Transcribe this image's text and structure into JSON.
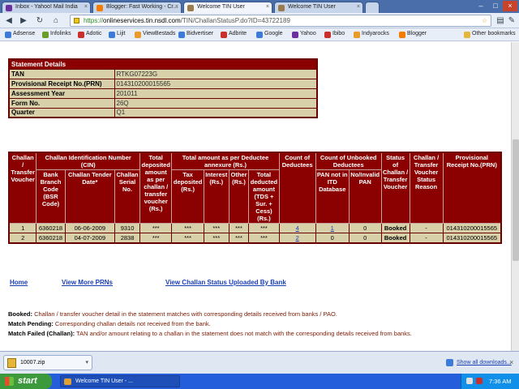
{
  "browser": {
    "tabs": [
      {
        "label": "Inbox - Yahoo! Mail India",
        "color": "#6b2fa0"
      },
      {
        "label": "Blogger: Fast Working - Cr...",
        "color": "#f57c00"
      },
      {
        "label": "Welcome TIN User",
        "color": "#9c7b4a"
      },
      {
        "label": "Welcome TIN User",
        "color": "#9c7b4a"
      }
    ],
    "url_scheme": "https://",
    "url_domain": "onlineservices.tin.nsdl.com",
    "url_path": "/TIN/ChallanStatusP.do?ID=43722189",
    "bookmarks": [
      {
        "label": "Adsense",
        "color": "#3d7bd8"
      },
      {
        "label": "Infolinks",
        "color": "#6a9c2a"
      },
      {
        "label": "Adotic",
        "color": "#c9302c"
      },
      {
        "label": "Lijit",
        "color": "#3d7bd8"
      },
      {
        "label": "ViewBestads",
        "color": "#e89a2a"
      },
      {
        "label": "Bidvertiser",
        "color": "#3d7bd8"
      },
      {
        "label": "Adbrite",
        "color": "#c9302c"
      },
      {
        "label": "Google",
        "color": "#3d7bd8"
      },
      {
        "label": "Yahoo",
        "color": "#6b2fa0"
      },
      {
        "label": "Ibibo",
        "color": "#c9302c"
      },
      {
        "label": "Indyarocks",
        "color": "#e89a2a"
      },
      {
        "label": "Blogger",
        "color": "#f57c00"
      }
    ],
    "other_bookmarks": "Other bookmarks"
  },
  "statement": {
    "header": "Statement Details",
    "rows": [
      {
        "label": "TAN",
        "value": "RTKG07223G"
      },
      {
        "label": "Provisional Receipt No.(PRN)",
        "value": "014310200015565"
      },
      {
        "label": "Assessment Year",
        "value": "201011"
      },
      {
        "label": "Form No.",
        "value": "26Q"
      },
      {
        "label": "Quarter",
        "value": "Q1"
      }
    ]
  },
  "challan": {
    "headers": {
      "voucher": "Challan / Transfer Voucher",
      "cin": "Challan Identification Number (CIN)",
      "bsr": "Bank Branch Code (BSR Code)",
      "tender_date": "Challan Tender Date*",
      "serial": "Challan Serial No.",
      "total_deposited": "Total deposited amount as per challan / transfer voucher (Rs.)",
      "total_annexure": "Total amount as per Deductee annexure (Rs.)",
      "tax_deposited": "Tax deposited (Rs.)",
      "interest": "Interest (Rs.)",
      "other": "Other (Rs.)",
      "total_deducted": "Total deducted amount (TDS + Sur. + Cess) (Rs.)",
      "count_deductees": "Count of Deductees",
      "count_unbooked": "Count of Unbooked Deductees",
      "pan_not_in_itd": "PAN not in ITD Database",
      "no_invalid_pan": "No/Invalid PAN",
      "status": "Status of Challan / Transfer Voucher",
      "status_reason": "Challan / Transfer Voucher Status Reason",
      "prn": "Provisional Receipt No.(PRN)"
    },
    "rows": [
      {
        "voucher": "1",
        "bsr": "6360218",
        "date": "06-06-2009",
        "serial": "9310",
        "total_deposited": "***",
        "tax_deposited": "***",
        "interest": "***",
        "other": "***",
        "total_deducted": "***",
        "count_deductees": "4",
        "pan_not_in_itd": "1",
        "no_invalid_pan": "0",
        "status": "Booked",
        "reason": "-",
        "prn": "014310200015565"
      },
      {
        "voucher": "2",
        "bsr": "6360218",
        "date": "04-07-2009",
        "serial": "2838",
        "total_deposited": "***",
        "tax_deposited": "***",
        "interest": "***",
        "other": "***",
        "total_deducted": "***",
        "count_deductees": "2",
        "pan_not_in_itd": "0",
        "no_invalid_pan": "0",
        "status": "Booked",
        "reason": "-",
        "prn": "014310200015565"
      }
    ]
  },
  "links": {
    "home": "Home",
    "view_more": "View More PRNs",
    "view_uploaded": "View Challan Status Uploaded By Bank"
  },
  "legend": [
    {
      "term": "Booked:",
      "text": " Challan / transfer voucher detail in the statement matches with corresponding details received from banks / PAO."
    },
    {
      "term": "Match Pending:",
      "text": " Corresponding challan details not received from the bank."
    },
    {
      "term": "Match Failed (Challan):",
      "text": " TAN and/or amount relating to a challan in the statement does not match with the corresponding details received from banks."
    }
  ],
  "downloads": {
    "file": "10007.zip",
    "show_all": "Show all downloads..."
  },
  "taskbar": {
    "start": "start",
    "window": "Welcome TIN User - ...",
    "time": "7:36 AM"
  }
}
